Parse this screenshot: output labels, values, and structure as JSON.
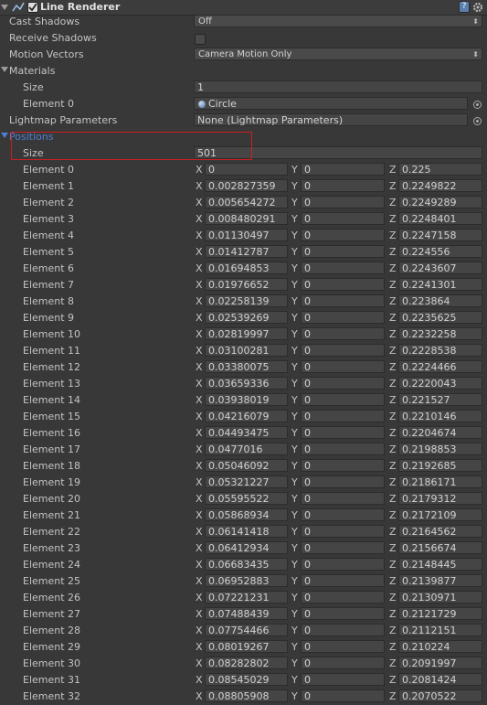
{
  "component": {
    "title": "Line Renderer",
    "enabled": true
  },
  "properties": {
    "cast_shadows": {
      "label": "Cast Shadows",
      "value": "Off"
    },
    "receive_shadows": {
      "label": "Receive Shadows",
      "checked": false
    },
    "motion_vectors": {
      "label": "Motion Vectors",
      "value": "Camera Motion Only"
    },
    "materials": {
      "label": "Materials",
      "size_label": "Size",
      "size": "1",
      "element_label": "Element 0",
      "element_value": "Circle"
    },
    "lightmap": {
      "label": "Lightmap Parameters",
      "value": "None (Lightmap Parameters)"
    }
  },
  "positions": {
    "label": "Positions",
    "size_label": "Size",
    "size": "501",
    "axis_labels": {
      "x": "X",
      "y": "Y",
      "z": "Z"
    },
    "elements": [
      {
        "name": "Element 0",
        "x": "0",
        "y": "0",
        "z": "0.225"
      },
      {
        "name": "Element 1",
        "x": "0.002827359",
        "y": "0",
        "z": "0.2249822"
      },
      {
        "name": "Element 2",
        "x": "0.005654272",
        "y": "0",
        "z": "0.2249289"
      },
      {
        "name": "Element 3",
        "x": "0.008480291",
        "y": "0",
        "z": "0.2248401"
      },
      {
        "name": "Element 4",
        "x": "0.01130497",
        "y": "0",
        "z": "0.2247158"
      },
      {
        "name": "Element 5",
        "x": "0.01412787",
        "y": "0",
        "z": "0.224556"
      },
      {
        "name": "Element 6",
        "x": "0.01694853",
        "y": "0",
        "z": "0.2243607"
      },
      {
        "name": "Element 7",
        "x": "0.01976652",
        "y": "0",
        "z": "0.2241301"
      },
      {
        "name": "Element 8",
        "x": "0.02258139",
        "y": "0",
        "z": "0.223864"
      },
      {
        "name": "Element 9",
        "x": "0.02539269",
        "y": "0",
        "z": "0.2235625"
      },
      {
        "name": "Element 10",
        "x": "0.02819997",
        "y": "0",
        "z": "0.2232258"
      },
      {
        "name": "Element 11",
        "x": "0.03100281",
        "y": "0",
        "z": "0.2228538"
      },
      {
        "name": "Element 12",
        "x": "0.03380075",
        "y": "0",
        "z": "0.2224466"
      },
      {
        "name": "Element 13",
        "x": "0.03659336",
        "y": "0",
        "z": "0.2220043"
      },
      {
        "name": "Element 14",
        "x": "0.03938019",
        "y": "0",
        "z": "0.221527"
      },
      {
        "name": "Element 15",
        "x": "0.04216079",
        "y": "0",
        "z": "0.2210146"
      },
      {
        "name": "Element 16",
        "x": "0.04493475",
        "y": "0",
        "z": "0.2204674"
      },
      {
        "name": "Element 17",
        "x": "0.0477016",
        "y": "0",
        "z": "0.2198853"
      },
      {
        "name": "Element 18",
        "x": "0.05046092",
        "y": "0",
        "z": "0.2192685"
      },
      {
        "name": "Element 19",
        "x": "0.05321227",
        "y": "0",
        "z": "0.2186171"
      },
      {
        "name": "Element 20",
        "x": "0.05595522",
        "y": "0",
        "z": "0.2179312"
      },
      {
        "name": "Element 21",
        "x": "0.05868934",
        "y": "0",
        "z": "0.2172109"
      },
      {
        "name": "Element 22",
        "x": "0.06141418",
        "y": "0",
        "z": "0.2164562"
      },
      {
        "name": "Element 23",
        "x": "0.06412934",
        "y": "0",
        "z": "0.2156674"
      },
      {
        "name": "Element 24",
        "x": "0.06683435",
        "y": "0",
        "z": "0.2148445"
      },
      {
        "name": "Element 25",
        "x": "0.06952883",
        "y": "0",
        "z": "0.2139877"
      },
      {
        "name": "Element 26",
        "x": "0.07221231",
        "y": "0",
        "z": "0.2130971"
      },
      {
        "name": "Element 27",
        "x": "0.07488439",
        "y": "0",
        "z": "0.2121729"
      },
      {
        "name": "Element 28",
        "x": "0.07754466",
        "y": "0",
        "z": "0.2112151"
      },
      {
        "name": "Element 29",
        "x": "0.08019267",
        "y": "0",
        "z": "0.210224"
      },
      {
        "name": "Element 30",
        "x": "0.08282802",
        "y": "0",
        "z": "0.2091997"
      },
      {
        "name": "Element 31",
        "x": "0.08545029",
        "y": "0",
        "z": "0.2081424"
      },
      {
        "name": "Element 32",
        "x": "0.08805908",
        "y": "0",
        "z": "0.2070522"
      }
    ]
  },
  "colors": {
    "background": "#383838",
    "positions_label": "#4a7fd6",
    "highlight_border": "#cc1f1f"
  },
  "icons": [
    "line-renderer-icon",
    "help-icon",
    "gear-icon",
    "circle-material-icon",
    "object-picker-icon"
  ]
}
